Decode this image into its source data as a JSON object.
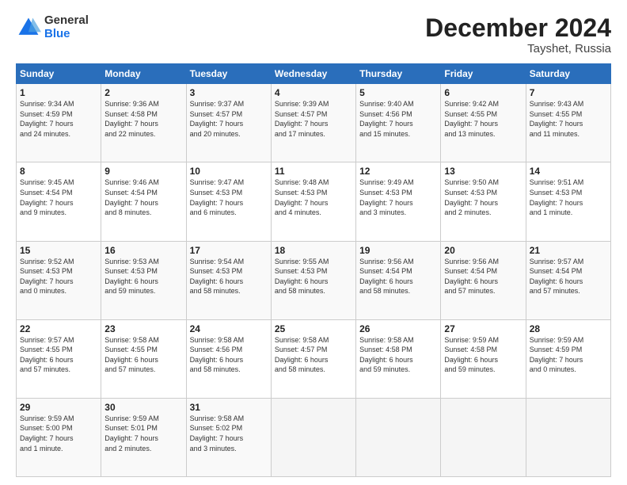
{
  "logo": {
    "general": "General",
    "blue": "Blue"
  },
  "title": {
    "month": "December 2024",
    "location": "Tayshet, Russia"
  },
  "weekdays": [
    "Sunday",
    "Monday",
    "Tuesday",
    "Wednesday",
    "Thursday",
    "Friday",
    "Saturday"
  ],
  "weeks": [
    [
      {
        "day": "1",
        "info": "Sunrise: 9:34 AM\nSunset: 4:59 PM\nDaylight: 7 hours\nand 24 minutes."
      },
      {
        "day": "2",
        "info": "Sunrise: 9:36 AM\nSunset: 4:58 PM\nDaylight: 7 hours\nand 22 minutes."
      },
      {
        "day": "3",
        "info": "Sunrise: 9:37 AM\nSunset: 4:57 PM\nDaylight: 7 hours\nand 20 minutes."
      },
      {
        "day": "4",
        "info": "Sunrise: 9:39 AM\nSunset: 4:57 PM\nDaylight: 7 hours\nand 17 minutes."
      },
      {
        "day": "5",
        "info": "Sunrise: 9:40 AM\nSunset: 4:56 PM\nDaylight: 7 hours\nand 15 minutes."
      },
      {
        "day": "6",
        "info": "Sunrise: 9:42 AM\nSunset: 4:55 PM\nDaylight: 7 hours\nand 13 minutes."
      },
      {
        "day": "7",
        "info": "Sunrise: 9:43 AM\nSunset: 4:55 PM\nDaylight: 7 hours\nand 11 minutes."
      }
    ],
    [
      {
        "day": "8",
        "info": "Sunrise: 9:45 AM\nSunset: 4:54 PM\nDaylight: 7 hours\nand 9 minutes."
      },
      {
        "day": "9",
        "info": "Sunrise: 9:46 AM\nSunset: 4:54 PM\nDaylight: 7 hours\nand 8 minutes."
      },
      {
        "day": "10",
        "info": "Sunrise: 9:47 AM\nSunset: 4:53 PM\nDaylight: 7 hours\nand 6 minutes."
      },
      {
        "day": "11",
        "info": "Sunrise: 9:48 AM\nSunset: 4:53 PM\nDaylight: 7 hours\nand 4 minutes."
      },
      {
        "day": "12",
        "info": "Sunrise: 9:49 AM\nSunset: 4:53 PM\nDaylight: 7 hours\nand 3 minutes."
      },
      {
        "day": "13",
        "info": "Sunrise: 9:50 AM\nSunset: 4:53 PM\nDaylight: 7 hours\nand 2 minutes."
      },
      {
        "day": "14",
        "info": "Sunrise: 9:51 AM\nSunset: 4:53 PM\nDaylight: 7 hours\nand 1 minute."
      }
    ],
    [
      {
        "day": "15",
        "info": "Sunrise: 9:52 AM\nSunset: 4:53 PM\nDaylight: 7 hours\nand 0 minutes."
      },
      {
        "day": "16",
        "info": "Sunrise: 9:53 AM\nSunset: 4:53 PM\nDaylight: 6 hours\nand 59 minutes."
      },
      {
        "day": "17",
        "info": "Sunrise: 9:54 AM\nSunset: 4:53 PM\nDaylight: 6 hours\nand 58 minutes."
      },
      {
        "day": "18",
        "info": "Sunrise: 9:55 AM\nSunset: 4:53 PM\nDaylight: 6 hours\nand 58 minutes."
      },
      {
        "day": "19",
        "info": "Sunrise: 9:56 AM\nSunset: 4:54 PM\nDaylight: 6 hours\nand 58 minutes."
      },
      {
        "day": "20",
        "info": "Sunrise: 9:56 AM\nSunset: 4:54 PM\nDaylight: 6 hours\nand 57 minutes."
      },
      {
        "day": "21",
        "info": "Sunrise: 9:57 AM\nSunset: 4:54 PM\nDaylight: 6 hours\nand 57 minutes."
      }
    ],
    [
      {
        "day": "22",
        "info": "Sunrise: 9:57 AM\nSunset: 4:55 PM\nDaylight: 6 hours\nand 57 minutes."
      },
      {
        "day": "23",
        "info": "Sunrise: 9:58 AM\nSunset: 4:55 PM\nDaylight: 6 hours\nand 57 minutes."
      },
      {
        "day": "24",
        "info": "Sunrise: 9:58 AM\nSunset: 4:56 PM\nDaylight: 6 hours\nand 58 minutes."
      },
      {
        "day": "25",
        "info": "Sunrise: 9:58 AM\nSunset: 4:57 PM\nDaylight: 6 hours\nand 58 minutes."
      },
      {
        "day": "26",
        "info": "Sunrise: 9:58 AM\nSunset: 4:58 PM\nDaylight: 6 hours\nand 59 minutes."
      },
      {
        "day": "27",
        "info": "Sunrise: 9:59 AM\nSunset: 4:58 PM\nDaylight: 6 hours\nand 59 minutes."
      },
      {
        "day": "28",
        "info": "Sunrise: 9:59 AM\nSunset: 4:59 PM\nDaylight: 7 hours\nand 0 minutes."
      }
    ],
    [
      {
        "day": "29",
        "info": "Sunrise: 9:59 AM\nSunset: 5:00 PM\nDaylight: 7 hours\nand 1 minute."
      },
      {
        "day": "30",
        "info": "Sunrise: 9:59 AM\nSunset: 5:01 PM\nDaylight: 7 hours\nand 2 minutes."
      },
      {
        "day": "31",
        "info": "Sunrise: 9:58 AM\nSunset: 5:02 PM\nDaylight: 7 hours\nand 3 minutes."
      },
      null,
      null,
      null,
      null
    ]
  ]
}
